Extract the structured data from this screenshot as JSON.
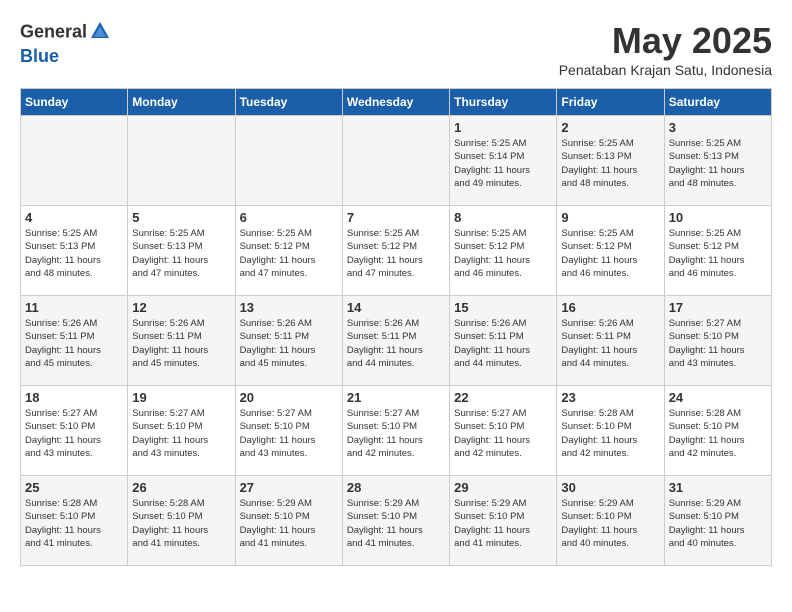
{
  "logo": {
    "general": "General",
    "blue": "Blue"
  },
  "header": {
    "month": "May 2025",
    "location": "Penataban Krajan Satu, Indonesia"
  },
  "days_of_week": [
    "Sunday",
    "Monday",
    "Tuesday",
    "Wednesday",
    "Thursday",
    "Friday",
    "Saturday"
  ],
  "weeks": [
    [
      {
        "day": "",
        "info": ""
      },
      {
        "day": "",
        "info": ""
      },
      {
        "day": "",
        "info": ""
      },
      {
        "day": "",
        "info": ""
      },
      {
        "day": "1",
        "info": "Sunrise: 5:25 AM\nSunset: 5:14 PM\nDaylight: 11 hours\nand 49 minutes."
      },
      {
        "day": "2",
        "info": "Sunrise: 5:25 AM\nSunset: 5:13 PM\nDaylight: 11 hours\nand 48 minutes."
      },
      {
        "day": "3",
        "info": "Sunrise: 5:25 AM\nSunset: 5:13 PM\nDaylight: 11 hours\nand 48 minutes."
      }
    ],
    [
      {
        "day": "4",
        "info": "Sunrise: 5:25 AM\nSunset: 5:13 PM\nDaylight: 11 hours\nand 48 minutes."
      },
      {
        "day": "5",
        "info": "Sunrise: 5:25 AM\nSunset: 5:13 PM\nDaylight: 11 hours\nand 47 minutes."
      },
      {
        "day": "6",
        "info": "Sunrise: 5:25 AM\nSunset: 5:12 PM\nDaylight: 11 hours\nand 47 minutes."
      },
      {
        "day": "7",
        "info": "Sunrise: 5:25 AM\nSunset: 5:12 PM\nDaylight: 11 hours\nand 47 minutes."
      },
      {
        "day": "8",
        "info": "Sunrise: 5:25 AM\nSunset: 5:12 PM\nDaylight: 11 hours\nand 46 minutes."
      },
      {
        "day": "9",
        "info": "Sunrise: 5:25 AM\nSunset: 5:12 PM\nDaylight: 11 hours\nand 46 minutes."
      },
      {
        "day": "10",
        "info": "Sunrise: 5:25 AM\nSunset: 5:12 PM\nDaylight: 11 hours\nand 46 minutes."
      }
    ],
    [
      {
        "day": "11",
        "info": "Sunrise: 5:26 AM\nSunset: 5:11 PM\nDaylight: 11 hours\nand 45 minutes."
      },
      {
        "day": "12",
        "info": "Sunrise: 5:26 AM\nSunset: 5:11 PM\nDaylight: 11 hours\nand 45 minutes."
      },
      {
        "day": "13",
        "info": "Sunrise: 5:26 AM\nSunset: 5:11 PM\nDaylight: 11 hours\nand 45 minutes."
      },
      {
        "day": "14",
        "info": "Sunrise: 5:26 AM\nSunset: 5:11 PM\nDaylight: 11 hours\nand 44 minutes."
      },
      {
        "day": "15",
        "info": "Sunrise: 5:26 AM\nSunset: 5:11 PM\nDaylight: 11 hours\nand 44 minutes."
      },
      {
        "day": "16",
        "info": "Sunrise: 5:26 AM\nSunset: 5:11 PM\nDaylight: 11 hours\nand 44 minutes."
      },
      {
        "day": "17",
        "info": "Sunrise: 5:27 AM\nSunset: 5:10 PM\nDaylight: 11 hours\nand 43 minutes."
      }
    ],
    [
      {
        "day": "18",
        "info": "Sunrise: 5:27 AM\nSunset: 5:10 PM\nDaylight: 11 hours\nand 43 minutes."
      },
      {
        "day": "19",
        "info": "Sunrise: 5:27 AM\nSunset: 5:10 PM\nDaylight: 11 hours\nand 43 minutes."
      },
      {
        "day": "20",
        "info": "Sunrise: 5:27 AM\nSunset: 5:10 PM\nDaylight: 11 hours\nand 43 minutes."
      },
      {
        "day": "21",
        "info": "Sunrise: 5:27 AM\nSunset: 5:10 PM\nDaylight: 11 hours\nand 42 minutes."
      },
      {
        "day": "22",
        "info": "Sunrise: 5:27 AM\nSunset: 5:10 PM\nDaylight: 11 hours\nand 42 minutes."
      },
      {
        "day": "23",
        "info": "Sunrise: 5:28 AM\nSunset: 5:10 PM\nDaylight: 11 hours\nand 42 minutes."
      },
      {
        "day": "24",
        "info": "Sunrise: 5:28 AM\nSunset: 5:10 PM\nDaylight: 11 hours\nand 42 minutes."
      }
    ],
    [
      {
        "day": "25",
        "info": "Sunrise: 5:28 AM\nSunset: 5:10 PM\nDaylight: 11 hours\nand 41 minutes."
      },
      {
        "day": "26",
        "info": "Sunrise: 5:28 AM\nSunset: 5:10 PM\nDaylight: 11 hours\nand 41 minutes."
      },
      {
        "day": "27",
        "info": "Sunrise: 5:29 AM\nSunset: 5:10 PM\nDaylight: 11 hours\nand 41 minutes."
      },
      {
        "day": "28",
        "info": "Sunrise: 5:29 AM\nSunset: 5:10 PM\nDaylight: 11 hours\nand 41 minutes."
      },
      {
        "day": "29",
        "info": "Sunrise: 5:29 AM\nSunset: 5:10 PM\nDaylight: 11 hours\nand 41 minutes."
      },
      {
        "day": "30",
        "info": "Sunrise: 5:29 AM\nSunset: 5:10 PM\nDaylight: 11 hours\nand 40 minutes."
      },
      {
        "day": "31",
        "info": "Sunrise: 5:29 AM\nSunset: 5:10 PM\nDaylight: 11 hours\nand 40 minutes."
      }
    ]
  ]
}
